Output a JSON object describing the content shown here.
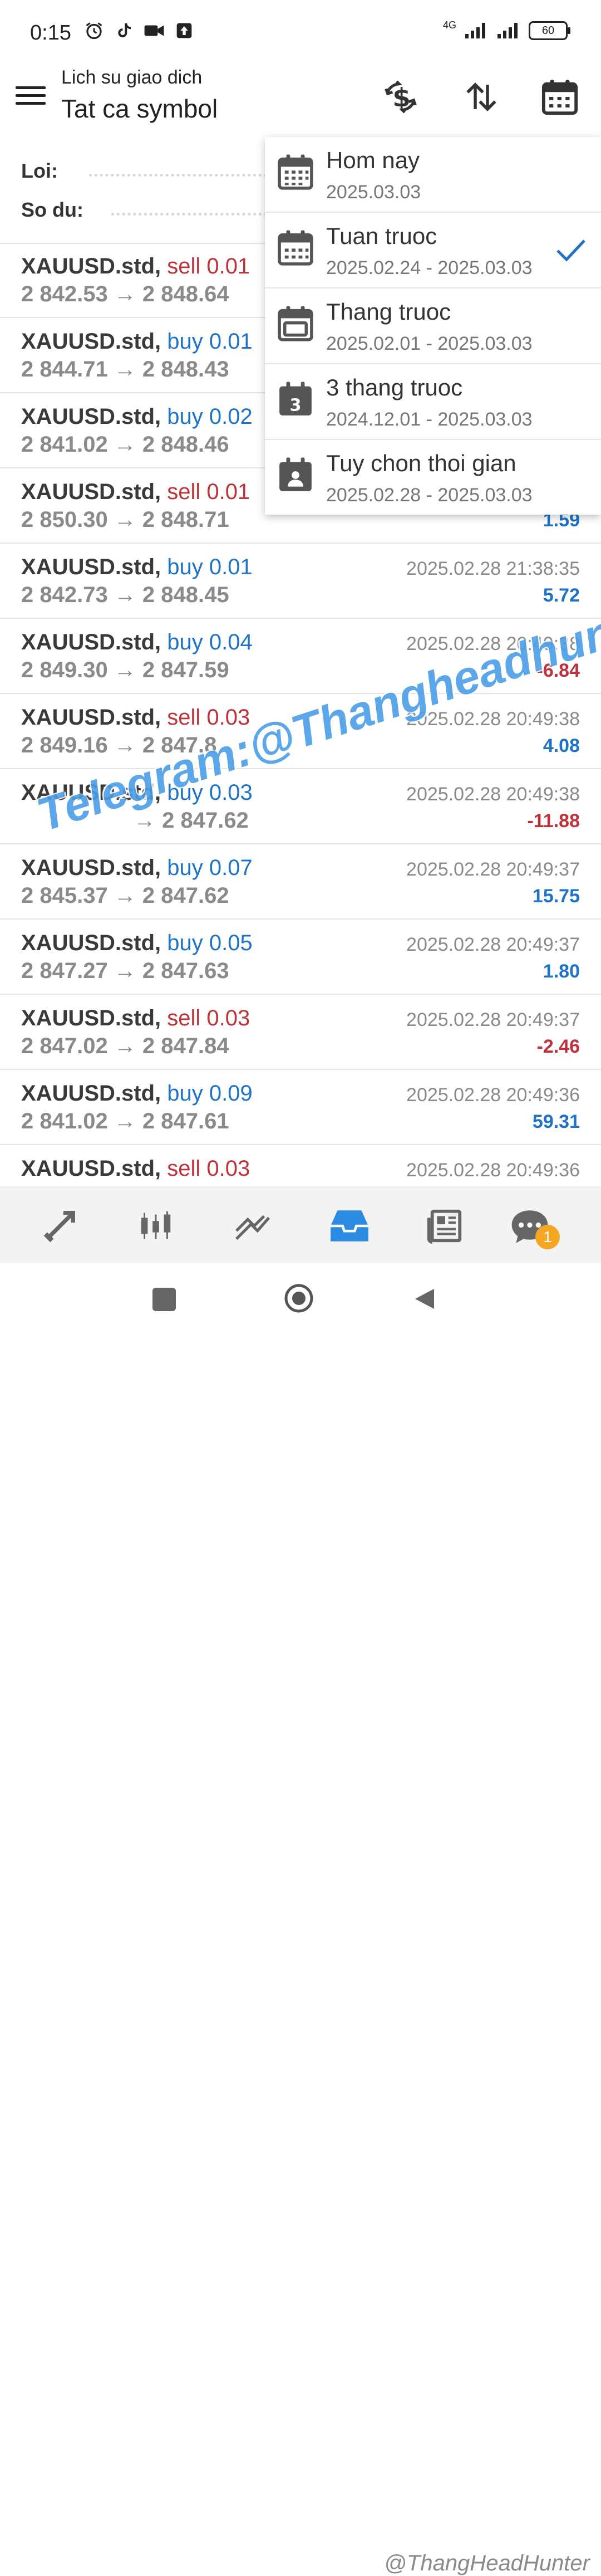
{
  "status_bar": {
    "time": "0:15",
    "network": "4G",
    "battery": "60"
  },
  "header": {
    "subtitle": "Lich su giao dich",
    "title": "Tat ca symbol"
  },
  "summary": {
    "profit_label": "Loi:",
    "balance_label": "So du:"
  },
  "trades": [
    {
      "symbol": "XAUUSD.std,",
      "side": "sell",
      "volume": "sell 0.01",
      "price": "2 842.53 → 2 848.64",
      "time": "",
      "profit": ""
    },
    {
      "symbol": "XAUUSD.std,",
      "side": "buy",
      "volume": "buy 0.01",
      "price": "2 844.71 → 2 848.43",
      "time": "",
      "profit": ""
    },
    {
      "symbol": "XAUUSD.std,",
      "side": "buy",
      "volume": "buy 0.02",
      "price": "2 841.02 → 2 848.46",
      "time": "",
      "profit": ""
    },
    {
      "symbol": "XAUUSD.std,",
      "side": "sell",
      "volume": "sell 0.01",
      "price": "2 850.30 → 2 848.71",
      "time": "",
      "profit": "1.59"
    },
    {
      "symbol": "XAUUSD.std,",
      "side": "buy",
      "volume": "buy 0.01",
      "price": "2 842.73 → 2 848.45",
      "time": "2025.02.28 21:38:35",
      "profit": "5.72"
    },
    {
      "symbol": "XAUUSD.std,",
      "side": "buy",
      "volume": "buy 0.04",
      "price": "2 849.30 → 2 847.59",
      "time": "2025.02.28 20:49:38",
      "profit": "-6.84"
    },
    {
      "symbol": "XAUUSD.std,",
      "side": "sell",
      "volume": "sell 0.03",
      "price": "2 849.16 → 2 847.8",
      "time": "2025.02.28 20:49:38",
      "profit": "4.08"
    },
    {
      "symbol": "XAUUSD.std,",
      "side": "buy",
      "volume": "buy 0.03",
      "price": "→ 2 847.62",
      "time": "2025.02.28 20:49:38",
      "profit": "-11.88"
    },
    {
      "symbol": "XAUUSD.std,",
      "side": "buy",
      "volume": "buy 0.07",
      "price": "2 845.37 → 2 847.62",
      "time": "2025.02.28 20:49:37",
      "profit": "15.75"
    },
    {
      "symbol": "XAUUSD.std,",
      "side": "buy",
      "volume": "buy 0.05",
      "price": "2 847.27 → 2 847.63",
      "time": "2025.02.28 20:49:37",
      "profit": "1.80"
    },
    {
      "symbol": "XAUUSD.std,",
      "side": "sell",
      "volume": "sell 0.03",
      "price": "2 847.02 → 2 847.84",
      "time": "2025.02.28 20:49:37",
      "profit": "-2.46"
    },
    {
      "symbol": "XAUUSD.std,",
      "side": "buy",
      "volume": "buy 0.09",
      "price": "2 841.02 → 2 847.61",
      "time": "2025.02.28 20:49:36",
      "profit": "59.31"
    },
    {
      "symbol": "XAUUSD.std,",
      "side": "sell",
      "volume": "sell 0.03",
      "price": "",
      "time": "2025.02.28 20:49:36",
      "profit": ""
    }
  ],
  "period_menu": [
    {
      "label": "Hom nay",
      "range": "2025.03.03",
      "icon": "calendar-grid-icon",
      "selected": false
    },
    {
      "label": "Tuan truoc",
      "range": "2025.02.24 - 2025.03.03",
      "icon": "calendar-week-icon",
      "selected": true
    },
    {
      "label": "Thang truoc",
      "range": "2025.02.01 - 2025.03.03",
      "icon": "calendar-month-icon",
      "selected": false
    },
    {
      "label": "3 thang truoc",
      "range": "2024.12.01 - 2025.03.03",
      "icon": "calendar-3-icon",
      "selected": false
    },
    {
      "label": "Tuy chon thoi gian",
      "range": "2025.02.28 - 2025.03.03",
      "icon": "calendar-custom-icon",
      "selected": false
    }
  ],
  "calendar_digit": "3",
  "bottom_nav": {
    "chat_badge": "1"
  },
  "watermark": "Telegram:@Thangheadhunter",
  "footer_watermark": "@ThangHeadHunter",
  "colors": {
    "sell": "#c0323a",
    "buy": "#1e73c8",
    "accent": "#1e73c8",
    "badge": "#f5a623"
  }
}
